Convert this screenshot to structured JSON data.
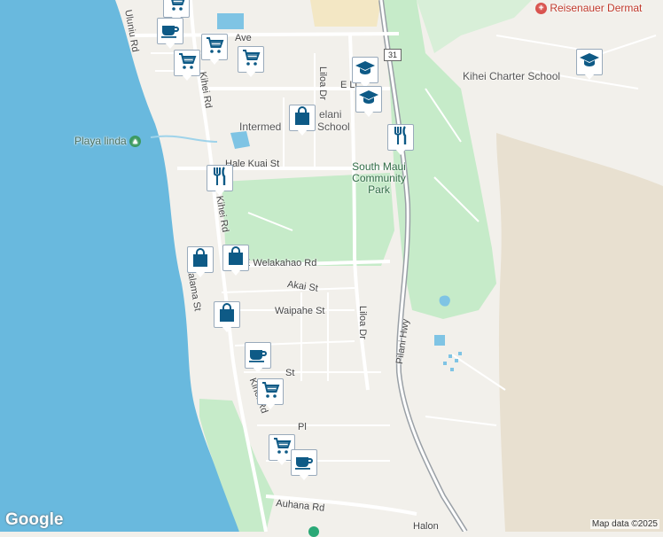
{
  "map": {
    "streets": {
      "uluniu": "Uluniu Rd",
      "kihei_top": "Kihei Rd",
      "kihei_mid": "Kihei Rd",
      "kihei_bottom": "Kihei Rd",
      "liloa_top": "Liloa Dr",
      "liloa_mid": "Liloa Dr",
      "hale_kuai": "Hale Kuai St",
      "welakahao": "E Welakahao Rd",
      "akai": "Akai St",
      "waipahe": "Waipahe St",
      "kalama": "Kalama St",
      "pilani": "Pilani Hwy",
      "auhana": "Auhana Rd",
      "halona": "Halon",
      "lipoa": "E Li",
      "ave": "Ave",
      "st_fragment": "St",
      "pl_fragment": "Pl",
      "route_shield": "31"
    },
    "places": {
      "playa_linda": "Playa linda",
      "south_maui_park": "South Maui Community Park",
      "kihei_charter": "Kihei Charter School",
      "intermediate": "Intermed",
      "school": "School",
      "kelani": "elani",
      "reisenauer": "Reisenauer Dermat"
    },
    "attribution": "Map data ©2025",
    "logo": "Google",
    "colors": {
      "water": "#69b9de",
      "land": "#f2f0eb",
      "park": "#c6ebc9",
      "road": "#ffffff",
      "highway": "#9aa0a6",
      "marker": "#0e5a86"
    },
    "markers": [
      {
        "name": "marker-cart",
        "icon": "cart-icon"
      },
      {
        "name": "marker-coffee",
        "icon": "coffee-icon"
      },
      {
        "name": "marker-cart",
        "icon": "cart-icon"
      },
      {
        "name": "marker-cart",
        "icon": "cart-icon"
      },
      {
        "name": "marker-cart",
        "icon": "cart-icon"
      },
      {
        "name": "marker-school",
        "icon": "graduation-cap-icon"
      },
      {
        "name": "marker-school",
        "icon": "graduation-cap-icon"
      },
      {
        "name": "marker-school",
        "icon": "graduation-cap-icon"
      },
      {
        "name": "marker-shopping",
        "icon": "shopping-bag-icon"
      },
      {
        "name": "marker-restaurant",
        "icon": "fork-knife-icon"
      },
      {
        "name": "marker-restaurant",
        "icon": "fork-knife-icon"
      },
      {
        "name": "marker-shopping",
        "icon": "shopping-bag-icon"
      },
      {
        "name": "marker-shopping",
        "icon": "shopping-bag-icon"
      },
      {
        "name": "marker-shopping",
        "icon": "shopping-bag-icon"
      },
      {
        "name": "marker-coffee",
        "icon": "coffee-icon"
      },
      {
        "name": "marker-cart",
        "icon": "cart-icon"
      },
      {
        "name": "marker-cart",
        "icon": "cart-icon"
      },
      {
        "name": "marker-coffee",
        "icon": "coffee-icon"
      }
    ]
  }
}
